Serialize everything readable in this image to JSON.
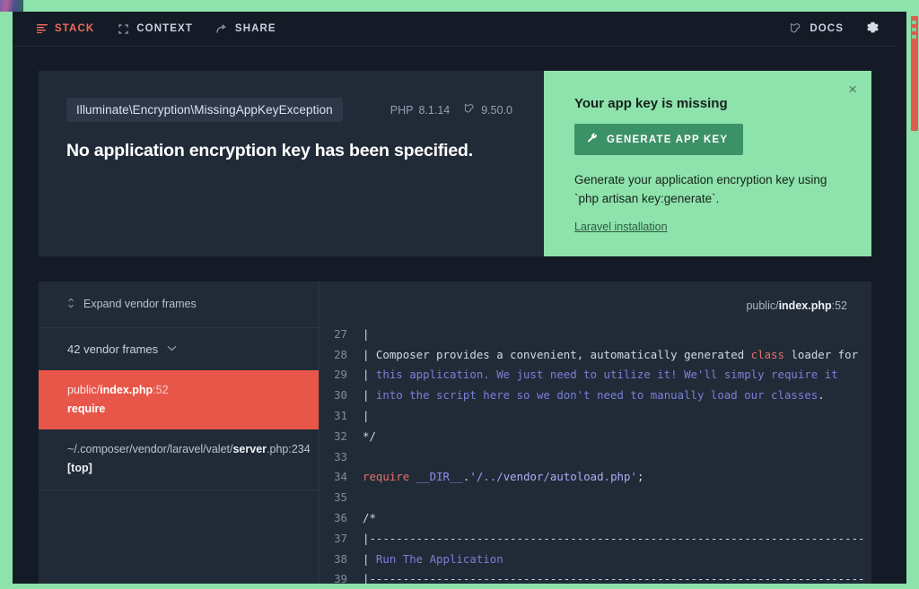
{
  "nav": {
    "tabs": [
      {
        "label": "STACK",
        "icon": "list-icon",
        "active": true
      },
      {
        "label": "CONTEXT",
        "icon": "brackets-icon",
        "active": false
      },
      {
        "label": "SHARE",
        "icon": "share-arrow-icon",
        "active": false
      }
    ],
    "docs_label": "DOCS",
    "docs_icon": "laravel-logo-icon",
    "settings_icon": "gear-icon"
  },
  "exception": {
    "class": "Illuminate\\Encryption\\MissingAppKeyException",
    "php_label": "PHP",
    "php_version": "8.1.14",
    "laravel_version": "9.50.0",
    "laravel_icon": "laravel-logo-icon",
    "message": "No application encryption key has been specified."
  },
  "solution": {
    "close_icon": "close-icon",
    "close_label": "×",
    "title": "Your app key is missing",
    "button_label": "GENERATE APP KEY",
    "button_icon": "wrench-icon",
    "description": "Generate your application encryption key using `php artisan key:generate`.",
    "link_label": "Laravel installation",
    "accent_color": "#8ee2ab",
    "button_color": "#3c9267"
  },
  "frames": {
    "expand_label": "Expand vendor frames",
    "expand_icon": "sort-updown-icon",
    "vendor_label": "42 vendor frames",
    "vendor_chevron_icon": "chevron-down-icon",
    "items": [
      {
        "path_prefix": "public/",
        "path_file": "index.php",
        "line": ":52",
        "method": "require",
        "active": true
      },
      {
        "path_prefix": "~/.composer/vendor/laravel/valet/",
        "path_file": "server",
        "line": ".php:234",
        "method": "[top]",
        "active": false
      }
    ],
    "active_color": "#e8564a"
  },
  "code": {
    "path_prefix": "public/",
    "path_file": "index.php",
    "path_line": ":52",
    "lines": [
      {
        "n": "27",
        "tokens": [
          {
            "t": "|",
            "c": "wh"
          }
        ]
      },
      {
        "n": "28",
        "tokens": [
          {
            "t": "| Composer provides a convenient, automatically generated ",
            "c": "wh"
          },
          {
            "t": "class",
            "c": "kw"
          },
          {
            "t": " loader for",
            "c": "wh"
          }
        ]
      },
      {
        "n": "29",
        "tokens": [
          {
            "t": "| ",
            "c": "wh"
          },
          {
            "t": "this application. We just need to utilize it! We'll simply require it",
            "c": "cm"
          }
        ]
      },
      {
        "n": "30",
        "tokens": [
          {
            "t": "| ",
            "c": "wh"
          },
          {
            "t": "into the script here so we don't need to manually load our classes",
            "c": "cm"
          },
          {
            "t": ".",
            "c": "wh"
          }
        ]
      },
      {
        "n": "31",
        "tokens": [
          {
            "t": "|",
            "c": "wh"
          }
        ]
      },
      {
        "n": "32",
        "tokens": [
          {
            "t": "*/",
            "c": "wh"
          }
        ]
      },
      {
        "n": "33",
        "tokens": [
          {
            "t": "",
            "c": "wh"
          }
        ]
      },
      {
        "n": "34",
        "tokens": [
          {
            "t": "require",
            "c": "kw"
          },
          {
            "t": " ",
            "c": "wh"
          },
          {
            "t": "__DIR__",
            "c": "pu"
          },
          {
            "t": ".",
            "c": "wh"
          },
          {
            "t": "'/../",
            "c": "st"
          },
          {
            "t": "vendor",
            "c": "id"
          },
          {
            "t": "/",
            "c": "st"
          },
          {
            "t": "autoload",
            "c": "id"
          },
          {
            "t": ".",
            "c": "st"
          },
          {
            "t": "php",
            "c": "id"
          },
          {
            "t": "'",
            "c": "st"
          },
          {
            "t": ";",
            "c": "wh"
          }
        ]
      },
      {
        "n": "35",
        "tokens": [
          {
            "t": "",
            "c": "wh"
          }
        ]
      },
      {
        "n": "36",
        "tokens": [
          {
            "t": "/*",
            "c": "wh"
          }
        ]
      },
      {
        "n": "37",
        "tokens": [
          {
            "t": "|--------------------------------------------------------------------------",
            "c": "wh"
          }
        ]
      },
      {
        "n": "38",
        "tokens": [
          {
            "t": "| ",
            "c": "wh"
          },
          {
            "t": "Run The Application",
            "c": "cm"
          }
        ]
      },
      {
        "n": "39",
        "tokens": [
          {
            "t": "|--------------------------------------------------------------------------",
            "c": "wh"
          }
        ]
      }
    ]
  },
  "scrollbar": {
    "name": "page-scrollbar",
    "thumb_color": "#e05a4e"
  }
}
